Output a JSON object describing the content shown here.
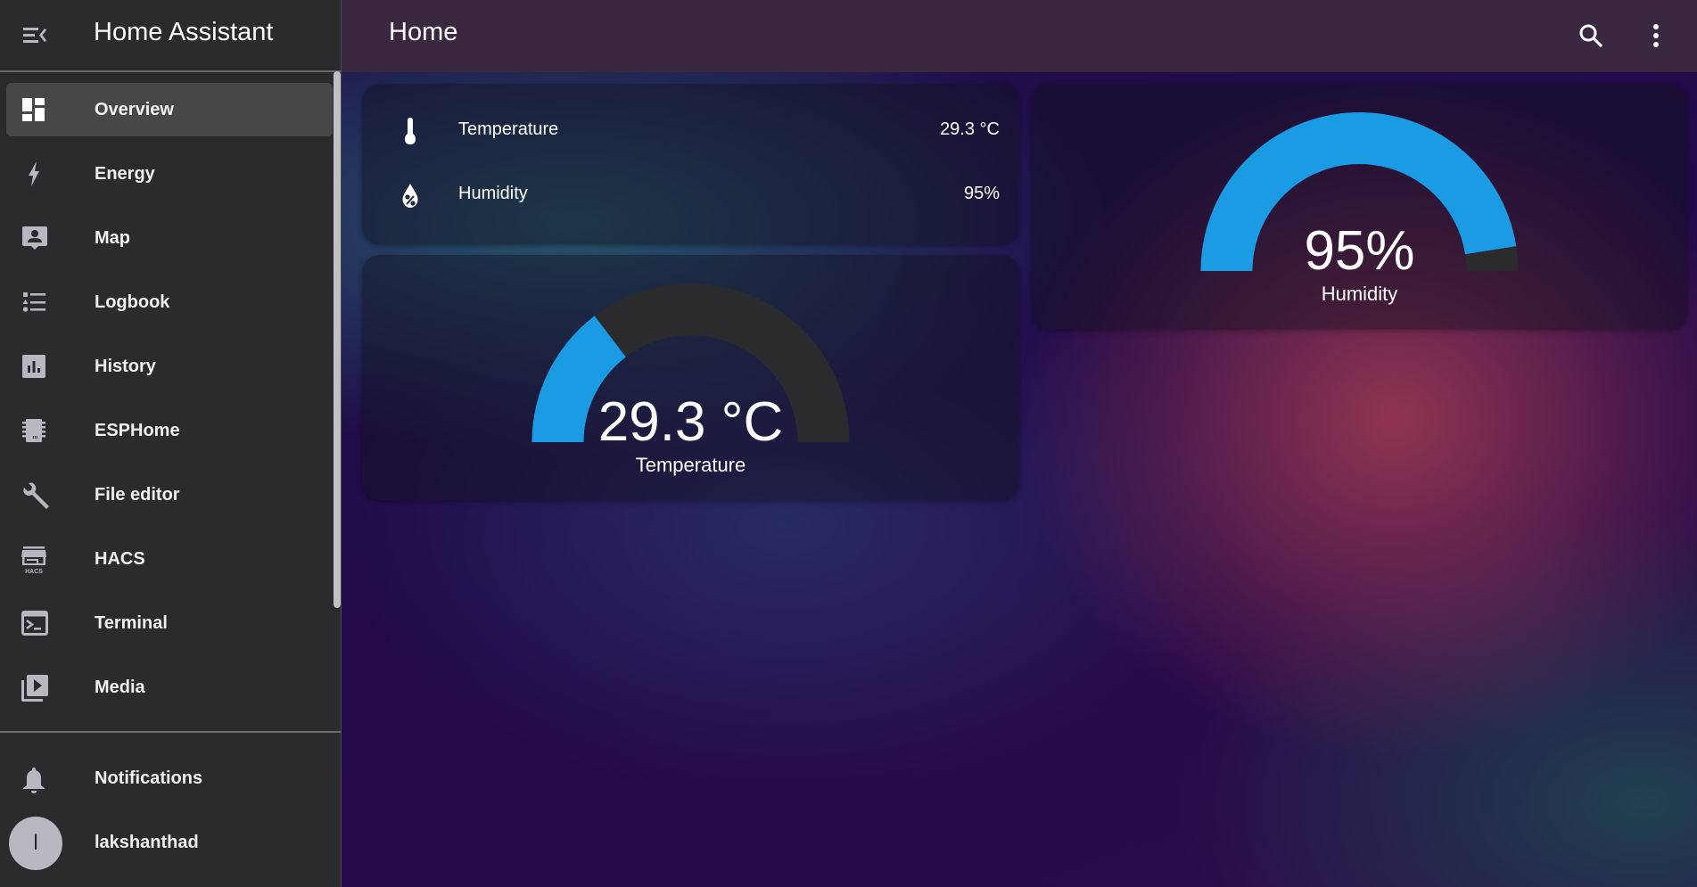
{
  "sidebar": {
    "app_title": "Home Assistant",
    "menu_icon": "menu-open-icon",
    "items": [
      {
        "label": "Overview",
        "icon": "view-dashboard-icon",
        "active": true
      },
      {
        "label": "Energy",
        "icon": "lightning-bolt-icon"
      },
      {
        "label": "Map",
        "icon": "map-account-icon"
      },
      {
        "label": "Logbook",
        "icon": "format-list-bulleted-type-icon"
      },
      {
        "label": "History",
        "icon": "chart-box-icon"
      },
      {
        "label": "ESPHome",
        "icon": "chip-icon"
      },
      {
        "label": "File editor",
        "icon": "wrench-icon"
      },
      {
        "label": "HACS",
        "icon": "hacs-store-icon"
      },
      {
        "label": "Terminal",
        "icon": "console-icon"
      },
      {
        "label": "Media",
        "icon": "play-box-multiple-icon"
      }
    ],
    "notifications_label": "Notifications",
    "user": {
      "name": "lakshanthad",
      "initial": "l"
    }
  },
  "header": {
    "title": "Home",
    "search_icon": "search-icon",
    "menu_icon": "dots-vertical-icon"
  },
  "entities_card": {
    "rows": [
      {
        "name": "Temperature",
        "value": "29.3 °C",
        "icon": "thermometer-icon"
      },
      {
        "name": "Humidity",
        "value": "95%",
        "icon": "water-percent-icon"
      }
    ]
  },
  "gauges": [
    {
      "name": "Temperature",
      "display": "29.3 °C",
      "value": 29.3,
      "min": 0,
      "max": 100
    },
    {
      "name": "Humidity",
      "display": "95%",
      "value": 95,
      "min": 0,
      "max": 100
    }
  ],
  "colors": {
    "gauge_fill": "#1a9be3",
    "gauge_track": "#2b2b2e",
    "sidebar_bg": "#2b2b2e",
    "topbar_bg": "#3a2840"
  }
}
